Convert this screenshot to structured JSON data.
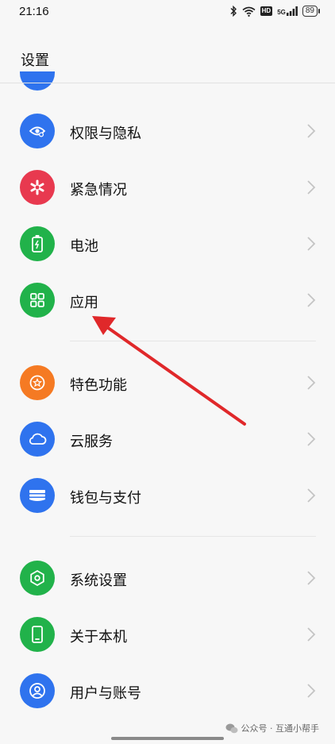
{
  "status_bar": {
    "time": "21:16",
    "battery": "89",
    "network_badge": "HD",
    "signal_label": "5G"
  },
  "header": {
    "title": "设置"
  },
  "menu": [
    {
      "label": "权限与隐私",
      "icon": "privacy-eye-icon",
      "color": "#2f73ee"
    },
    {
      "label": "紧急情况",
      "icon": "emergency-asterisk-icon",
      "color": "#e8394f"
    },
    {
      "label": "电池",
      "icon": "battery-icon",
      "color": "#21b24a"
    },
    {
      "label": "应用",
      "icon": "apps-grid-icon",
      "color": "#21b24a"
    },
    {
      "label": "特色功能",
      "icon": "star-icon",
      "color": "#f57a23"
    },
    {
      "label": "云服务",
      "icon": "cloud-icon",
      "color": "#2f73ee"
    },
    {
      "label": "钱包与支付",
      "icon": "wallet-icon",
      "color": "#2f73ee"
    },
    {
      "label": "系统设置",
      "icon": "system-hexagon-icon",
      "color": "#21b24a"
    },
    {
      "label": "关于本机",
      "icon": "phone-icon",
      "color": "#21b24a"
    },
    {
      "label": "用户与账号",
      "icon": "user-icon",
      "color": "#2f73ee"
    }
  ],
  "watermark": {
    "text": "公众号 · 互通小帮手"
  },
  "annotation": {
    "type": "red-arrow",
    "target": "应用"
  }
}
